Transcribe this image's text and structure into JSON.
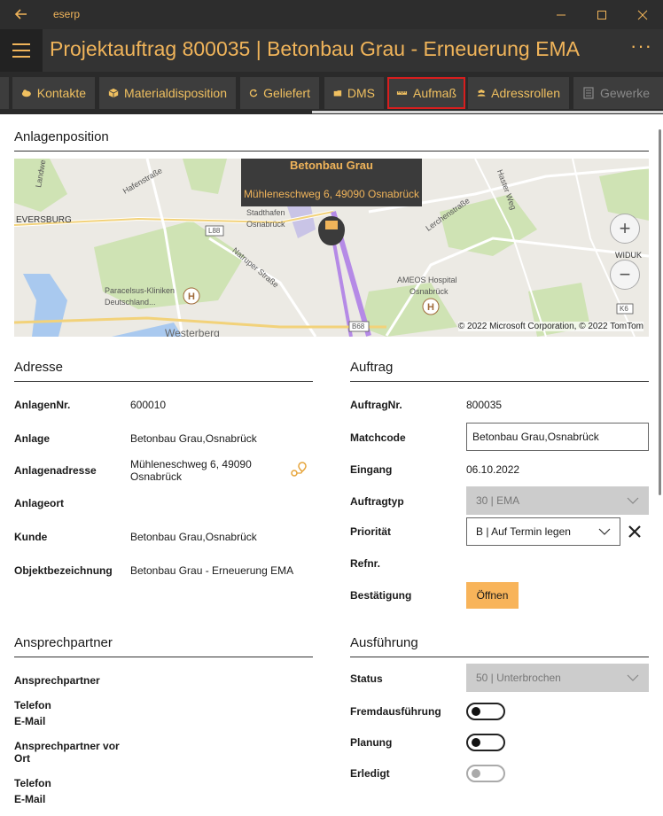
{
  "window": {
    "app_name": "eserp",
    "accent": "#f0b45a"
  },
  "header": {
    "title": "Projektauftrag 800035  |  Betonbau Grau - Erneuerung EMA"
  },
  "tabs": [
    {
      "label": "Kontakte",
      "icon": "contacts-icon"
    },
    {
      "label": "Materialdisposition",
      "icon": "cube-icon"
    },
    {
      "label": "Geliefert",
      "icon": "refresh-icon"
    },
    {
      "label": "DMS",
      "icon": "folder-icon"
    },
    {
      "label": "Aufmaß",
      "icon": "ruler-icon",
      "active": true
    },
    {
      "label": "Adressrollen",
      "icon": "people-icon"
    },
    {
      "label": "Gewerke",
      "icon": "list-icon",
      "disabled": true
    }
  ],
  "sections": {
    "anlagenposition": "Anlagenposition",
    "adresse": "Adresse",
    "auftrag": "Auftrag",
    "ansprechpartner": "Ansprechpartner",
    "ausfuehrung": "Ausführung"
  },
  "map": {
    "tooltip_title": "Betonbau Grau",
    "tooltip_address": "Mühleneschweg 6, 49090 Osnabrück",
    "copyright": "© 2022 Microsoft Corporation, © 2022 TomTom",
    "zoom_in": "+",
    "zoom_out": "−",
    "places": {
      "eversburg": "EVERSBURG",
      "stadthafen": "Stadthafen",
      "osnabrueck": "Osnabrück",
      "paracelsus1": "Paracelsus-Kliniken",
      "paracelsus2": "Deutschland...",
      "ameos1": "AMEOS Hospital",
      "ameos2": "Osnabrück",
      "westerberg": "Westerberg",
      "widuk": "WIDUK",
      "natruper": "Natruper Straße",
      "l88": "L88",
      "b68": "B68",
      "k6": "K6",
      "landwehr": "Landwe",
      "hafenstrasse": "Hafenstraße",
      "lerchenstrasse": "Lerchenstraße",
      "hasteweg": "Haster Weg"
    }
  },
  "adresse": {
    "rows": [
      {
        "label": "AnlagenNr.",
        "value": "600010"
      },
      {
        "label": "Anlage",
        "value": "Betonbau Grau,Osnabrück"
      },
      {
        "label": "Anlagenadresse",
        "value": "Mühleneschweg 6, 49090\nOsnabrück"
      },
      {
        "label": "Anlageort",
        "value": ""
      },
      {
        "label": "Kunde",
        "value": "Betonbau Grau,Osnabrück"
      },
      {
        "label": "Objektbezeichnung",
        "value": "Betonbau Grau - Erneuerung EMA"
      }
    ]
  },
  "auftrag": {
    "auftragnr_label": "AuftragNr.",
    "auftragnr": "800035",
    "matchcode_label": "Matchcode",
    "matchcode": "Betonbau Grau,Osnabrück",
    "eingang_label": "Eingang",
    "eingang": "06.10.2022",
    "auftragtyp_label": "Auftragtyp",
    "auftragtyp": "30  |  EMA",
    "prioritaet_label": "Priorität",
    "prioritaet": "B  |  Auf Termin legen",
    "refnr_label": "Refnr.",
    "bestaetigung_label": "Bestätigung",
    "oeffnen": "Öffnen"
  },
  "ansprechpartner": {
    "ansprechpartner": "Ansprechpartner",
    "telefon": "Telefon",
    "email": "E-Mail",
    "vor_ort": "Ansprechpartner vor\nOrt",
    "telefon2": "Telefon",
    "email2": "E-Mail"
  },
  "ausfuehrung": {
    "status_label": "Status",
    "status": "50  |  Unterbrochen",
    "fremd_label": "Fremdausführung",
    "planung_label": "Planung",
    "erledigt_label": "Erledigt"
  }
}
